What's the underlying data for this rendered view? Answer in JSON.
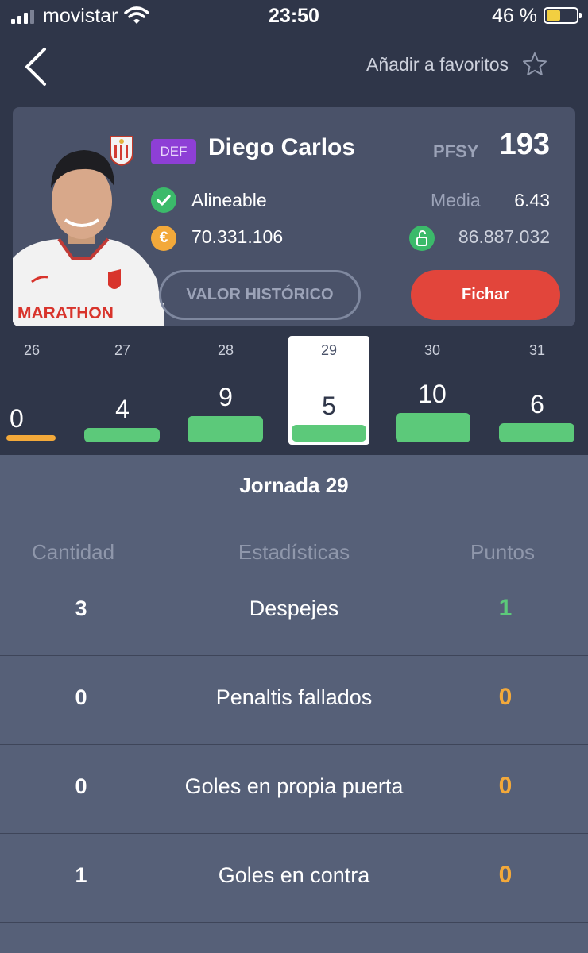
{
  "status_bar": {
    "carrier": "movistar",
    "time": "23:50",
    "battery_text": "46 %",
    "battery_level": 0.46
  },
  "nav": {
    "favorite_label": "Añadir a favoritos"
  },
  "player": {
    "position": "DEF",
    "name": "Diego Carlos",
    "pfsy_label": "PFSY",
    "pfsy_value": "193",
    "status": "Alineable",
    "media_label": "Media",
    "media_value": "6.43",
    "market_value": "70.331.106",
    "clause_value": "86.887.032",
    "euro_symbol": "€",
    "history_button": "VALOR HISTÓRICO",
    "sign_button": "Fichar",
    "shirt_text": "MARATHON"
  },
  "colors": {
    "accent_green": "#5cc97a",
    "accent_orange": "#f3a93a",
    "accent_red": "#e2453b",
    "badge_purple": "#8e3fd6"
  },
  "rounds": [
    {
      "number": "26",
      "points": "0"
    },
    {
      "number": "27",
      "points": "4"
    },
    {
      "number": "28",
      "points": "9"
    },
    {
      "number": "29",
      "points": "5",
      "selected": true
    },
    {
      "number": "30",
      "points": "10"
    },
    {
      "number": "31",
      "points": "6"
    }
  ],
  "stats": {
    "title": "Jornada 29",
    "headers": {
      "quantity": "Cantidad",
      "stat": "Estadísticas",
      "points": "Puntos"
    },
    "rows": [
      {
        "quantity": "3",
        "name": "Despejes",
        "points": "1"
      },
      {
        "quantity": "0",
        "name": "Penaltis fallados",
        "points": "0"
      },
      {
        "quantity": "0",
        "name": "Goles en propia puerta",
        "points": "0"
      },
      {
        "quantity": "1",
        "name": "Goles en contra",
        "points": "0"
      }
    ]
  }
}
